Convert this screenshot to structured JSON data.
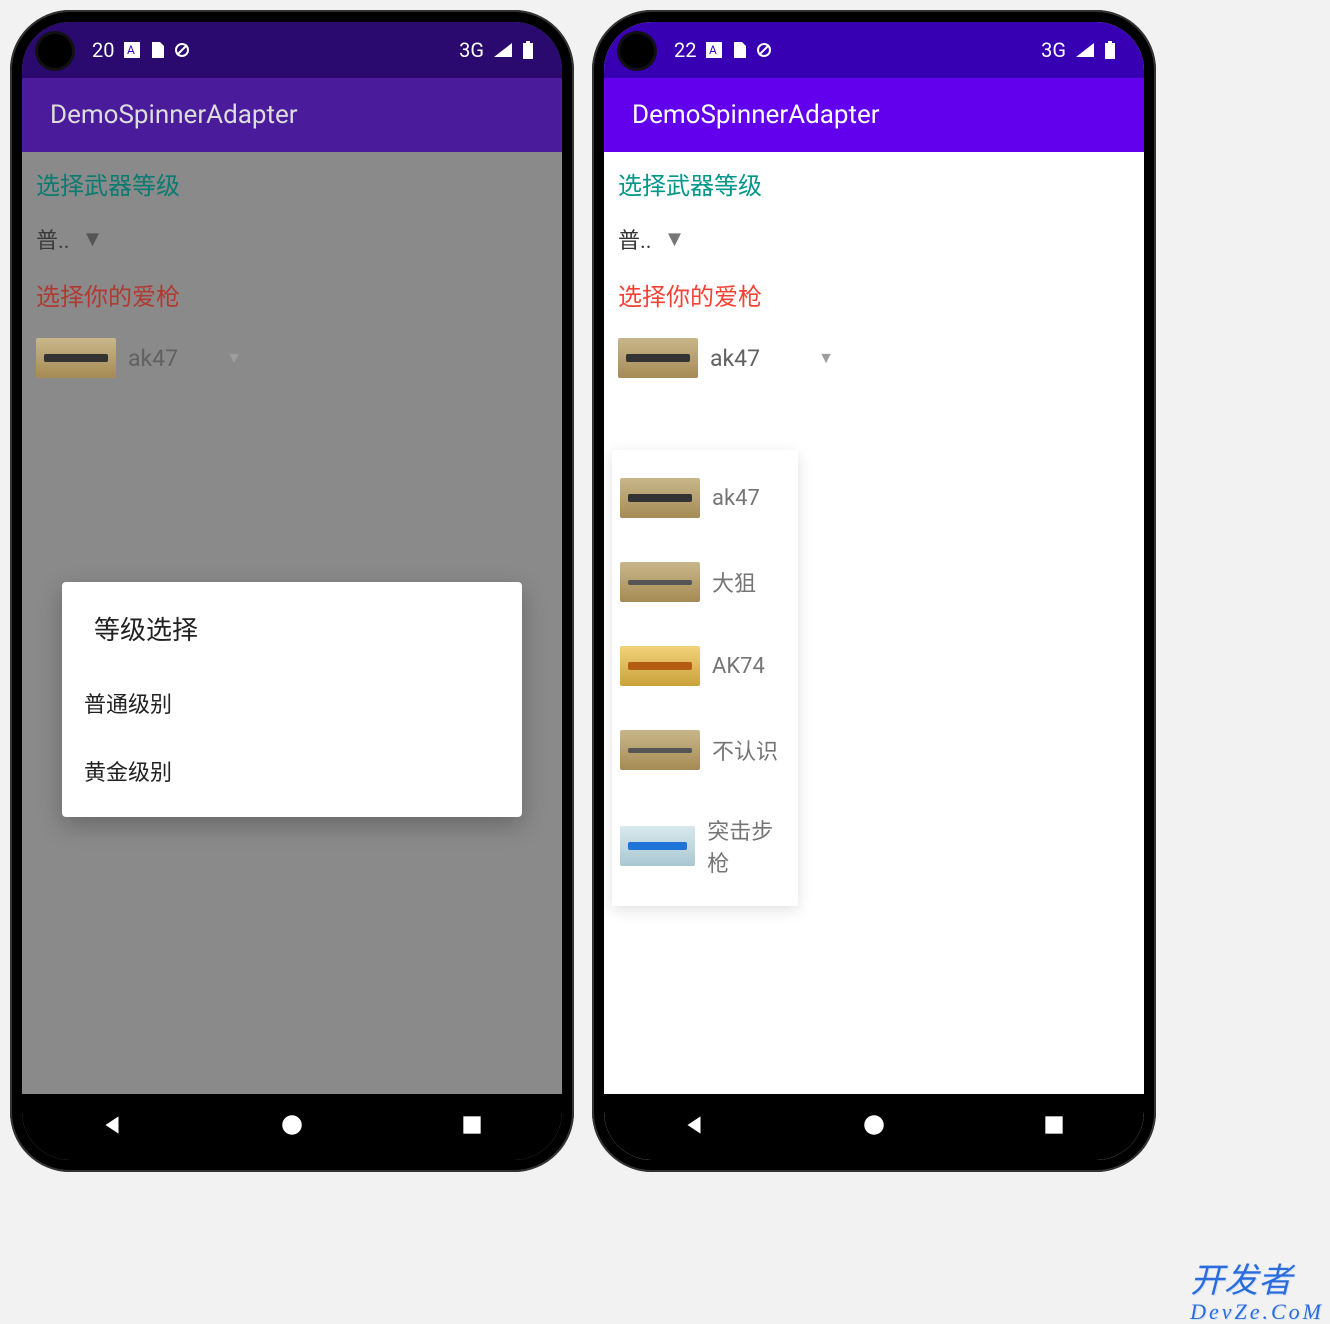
{
  "watermark": {
    "line1": "开发者",
    "line2": "DevZe.CoM"
  },
  "phones": {
    "left": {
      "status": {
        "clock": "20",
        "icons_left": [
          "A",
          "card",
          "donot"
        ],
        "net": "3G"
      },
      "app_title": "DemoSpinnerAdapter",
      "label_level": "选择武器等级",
      "spinner_level_value": "普..",
      "label_gun": "选择你的爱枪",
      "spinner_gun_value": "ak47",
      "dialog": {
        "title": "等级选择",
        "items": [
          "普通级别",
          "黄金级别"
        ]
      }
    },
    "right": {
      "status": {
        "clock": "22",
        "icons_left": [
          "A",
          "card",
          "donot"
        ],
        "net": "3G"
      },
      "app_title": "DemoSpinnerAdapter",
      "label_level": "选择武器等级",
      "spinner_level_value": "普..",
      "label_gun": "选择你的爱枪",
      "spinner_gun_value": "ak47",
      "dropdown": {
        "items": [
          {
            "name": "ak47",
            "thumb": "default"
          },
          {
            "name": "大狙",
            "thumb": "sniper"
          },
          {
            "name": "AK74",
            "thumb": "gold"
          },
          {
            "name": "不认识",
            "thumb": "sniper"
          },
          {
            "name": "突击步枪",
            "thumb": "blue"
          }
        ]
      }
    }
  }
}
